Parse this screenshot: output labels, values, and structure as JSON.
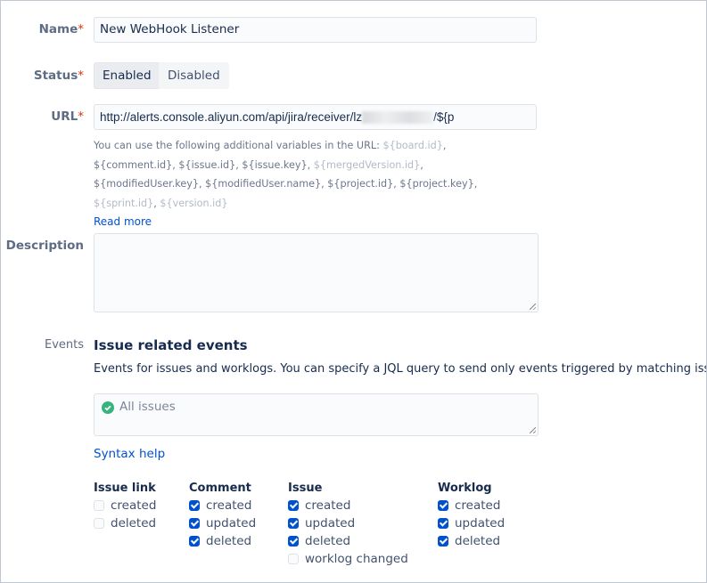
{
  "name": {
    "label": "Name",
    "required": "*",
    "value": "New WebHook Listener"
  },
  "status": {
    "label": "Status",
    "required": "*",
    "options": [
      "Enabled",
      "Disabled"
    ],
    "selected": "Enabled"
  },
  "url": {
    "label": "URL",
    "required": "*",
    "value_start": "http://alerts.console.aliyun.com/api/jira/receiver/lz",
    "value_end": "/${p",
    "help_prefix": "You can use the following additional variables in the URL: ",
    "variables": [
      {
        "t": "${board.id}",
        "dim": true
      },
      {
        "t": "${comment.id}",
        "dim": false
      },
      {
        "t": "${issue.id}",
        "dim": false
      },
      {
        "t": "${issue.key}",
        "dim": false
      },
      {
        "t": "${mergedVersion.id}",
        "dim": true
      },
      {
        "t": "${modifiedUser.key}",
        "dim": false
      },
      {
        "t": "${modifiedUser.name}",
        "dim": false
      },
      {
        "t": "${project.id}",
        "dim": false
      },
      {
        "t": "${project.key}",
        "dim": false
      },
      {
        "t": "${sprint.id}",
        "dim": true
      },
      {
        "t": "${version.id}",
        "dim": true
      }
    ],
    "read_more": "Read more"
  },
  "description": {
    "label": "Description",
    "value": ""
  },
  "events": {
    "label": "Events",
    "title": "Issue related events",
    "desc": "Events for issues and worklogs. You can specify a JQL query to send only events triggered by matching issues.",
    "jql": "All issues",
    "syntax_help": "Syntax help",
    "groups": [
      {
        "title": "Issue link",
        "items": [
          {
            "label": "created",
            "checked": false
          },
          {
            "label": "deleted",
            "checked": false
          }
        ]
      },
      {
        "title": "Comment",
        "items": [
          {
            "label": "created",
            "checked": true
          },
          {
            "label": "updated",
            "checked": true
          },
          {
            "label": "deleted",
            "checked": true
          }
        ]
      },
      {
        "title": "Issue",
        "items": [
          {
            "label": "created",
            "checked": true
          },
          {
            "label": "updated",
            "checked": true
          },
          {
            "label": "deleted",
            "checked": true
          },
          {
            "label": "worklog changed",
            "checked": false
          }
        ]
      },
      {
        "title": "Worklog",
        "items": [
          {
            "label": "created",
            "checked": true
          },
          {
            "label": "updated",
            "checked": true
          },
          {
            "label": "deleted",
            "checked": true
          }
        ]
      }
    ]
  },
  "colors": {
    "accent": "#0052cc",
    "required": "#de350b",
    "success": "#36b37e"
  }
}
